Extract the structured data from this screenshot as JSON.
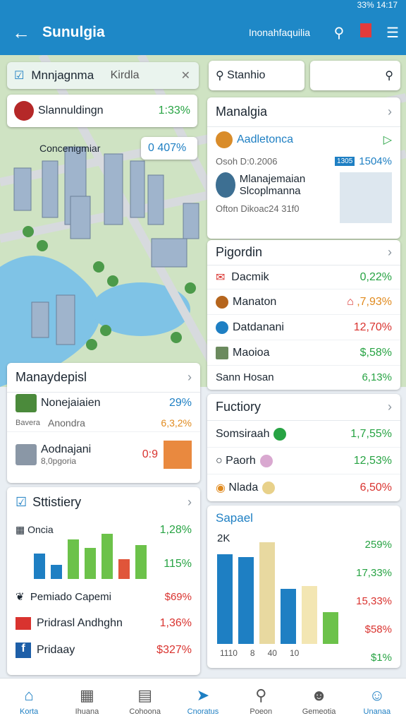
{
  "status": "33% 14:17",
  "appbar": {
    "title": "Sunulgia",
    "subtitle": "Inonahfaquilia"
  },
  "map_overlay": {
    "tab_label": "Mnnjagnma",
    "tab_value": "Kirdla",
    "item1_label": "Slannuldingn",
    "item1_value": "1:33%",
    "item2_label": "Concenigmiar",
    "item2_value": "0 407%"
  },
  "search": {
    "label": "Stanhio",
    "placeholder": ""
  },
  "card_manalgia": {
    "title": "Manalgia",
    "row1": {
      "label": "Aadletonca",
      "meta": "Osoh D:0.2006",
      "badge": "1305",
      "value": "1504%"
    },
    "row2": {
      "label": "Mlanajemaian Slcoplmanna",
      "meta": "Ofton Dikoac24 31f0"
    }
  },
  "card_pigordin": {
    "title": "Pigordin",
    "rows": [
      {
        "label": "Dacmik",
        "value": "0,22%"
      },
      {
        "label": "Manaton",
        "value": ",7,93%"
      },
      {
        "label": "Datdanani",
        "value": "12,70%"
      },
      {
        "label": "Maoioa",
        "value": "$,58%"
      },
      {
        "label": "Sann Hosan",
        "value": "6,13%"
      }
    ]
  },
  "card_manaydepisl": {
    "title": "Manaydepisl",
    "row1": {
      "label": "Nonejaiaien",
      "value": "29%",
      "meta": "Bavera",
      "meta2": "Anondra",
      "value2": "6,3,2%"
    },
    "row2": {
      "label": "Aodnajani",
      "meta": "8,0pgoria",
      "value": "0:9"
    }
  },
  "card_fuctiory": {
    "title": "Fuctiory",
    "rows": [
      {
        "label": "Somsiraah",
        "value": "1,7,55%"
      },
      {
        "label": "Paorh",
        "value": "12,53%"
      },
      {
        "label": "Nlada",
        "value": "6,50%"
      }
    ]
  },
  "card_stats": {
    "title": "Sttistiery",
    "label1": "Oncia",
    "value1": "1,28%",
    "value2": "115%",
    "rows": [
      {
        "label": "Pemiado Capemi",
        "value": "$69%"
      },
      {
        "label": "Pridrasl Andhghn",
        "value": "1,36%"
      },
      {
        "label": "Pridaay",
        "value": "$327%"
      }
    ]
  },
  "card_sapael": {
    "title": "Sapael",
    "ylabel": "2K",
    "values": [
      "259%",
      "17,33%",
      "15,33%",
      "$58%",
      "$1%"
    ],
    "xticks": [
      "1110",
      "8",
      "40",
      "10"
    ]
  },
  "chart_data": [
    {
      "type": "bar",
      "title": "Sttistiery",
      "values": [
        0.45,
        0.25,
        0.7,
        0.55,
        0.8,
        0.35,
        0.6
      ],
      "colors": [
        "#1e7fc3",
        "#1e7fc3",
        "#6cc24a",
        "#6cc24a",
        "#6cc24a",
        "#e0553a",
        "#6cc24a"
      ]
    },
    {
      "type": "bar",
      "title": "Sapael",
      "values": [
        0.85,
        0.82,
        0.96,
        0.52,
        0.55,
        0.3
      ],
      "colors": [
        "#1e7fc3",
        "#1e7fc3",
        "#e8d9a0",
        "#1e7fc3",
        "#f3e6b3",
        "#6cc24a"
      ]
    }
  ],
  "nav": [
    {
      "label": "Korta",
      "icon": "home-icon"
    },
    {
      "label": "Ihuana",
      "icon": "image-icon"
    },
    {
      "label": "Cohoona",
      "icon": "calendar-icon"
    },
    {
      "label": "Cnoratus",
      "icon": "compass-icon"
    },
    {
      "label": "Poeon",
      "icon": "search-icon"
    },
    {
      "label": "Gemeotia",
      "icon": "person-icon"
    },
    {
      "label": "Unanaa",
      "icon": "account-icon"
    }
  ]
}
